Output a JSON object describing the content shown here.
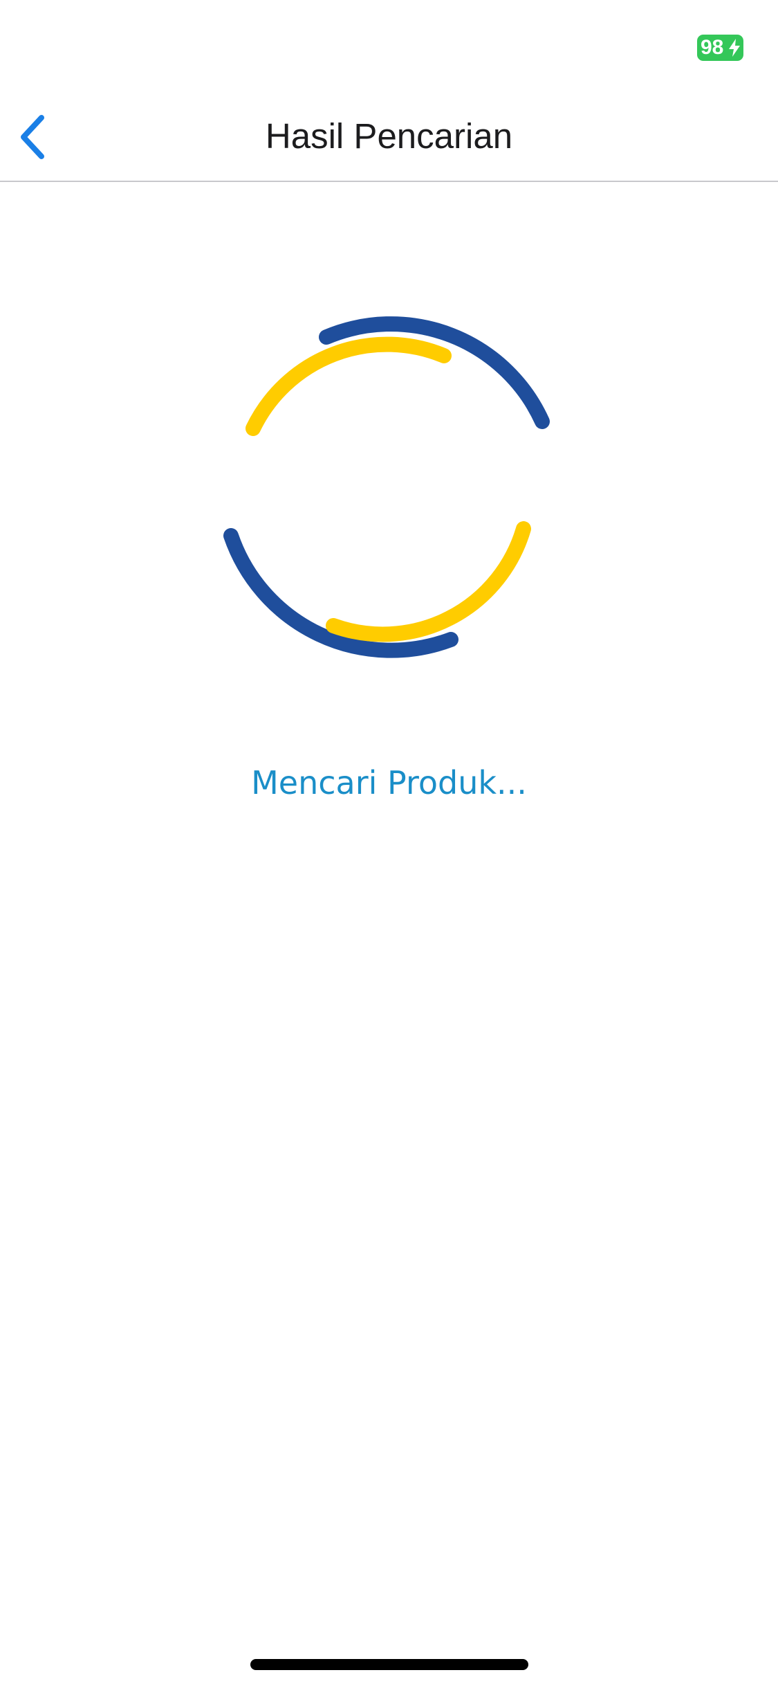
{
  "status_bar": {
    "battery_level": "98"
  },
  "nav_bar": {
    "title": "Hasil Pencarian"
  },
  "main": {
    "loading_text": "Mencari Produk..."
  },
  "colors": {
    "spinner_blue": "#1f4e9c",
    "spinner_yellow": "#ffcc00",
    "accent_blue": "#1a8ec8",
    "back_icon": "#1a7fe6",
    "battery_green": "#34c759"
  },
  "icons": {
    "back": "chevron-left-icon",
    "battery": "battery-charging-icon"
  }
}
